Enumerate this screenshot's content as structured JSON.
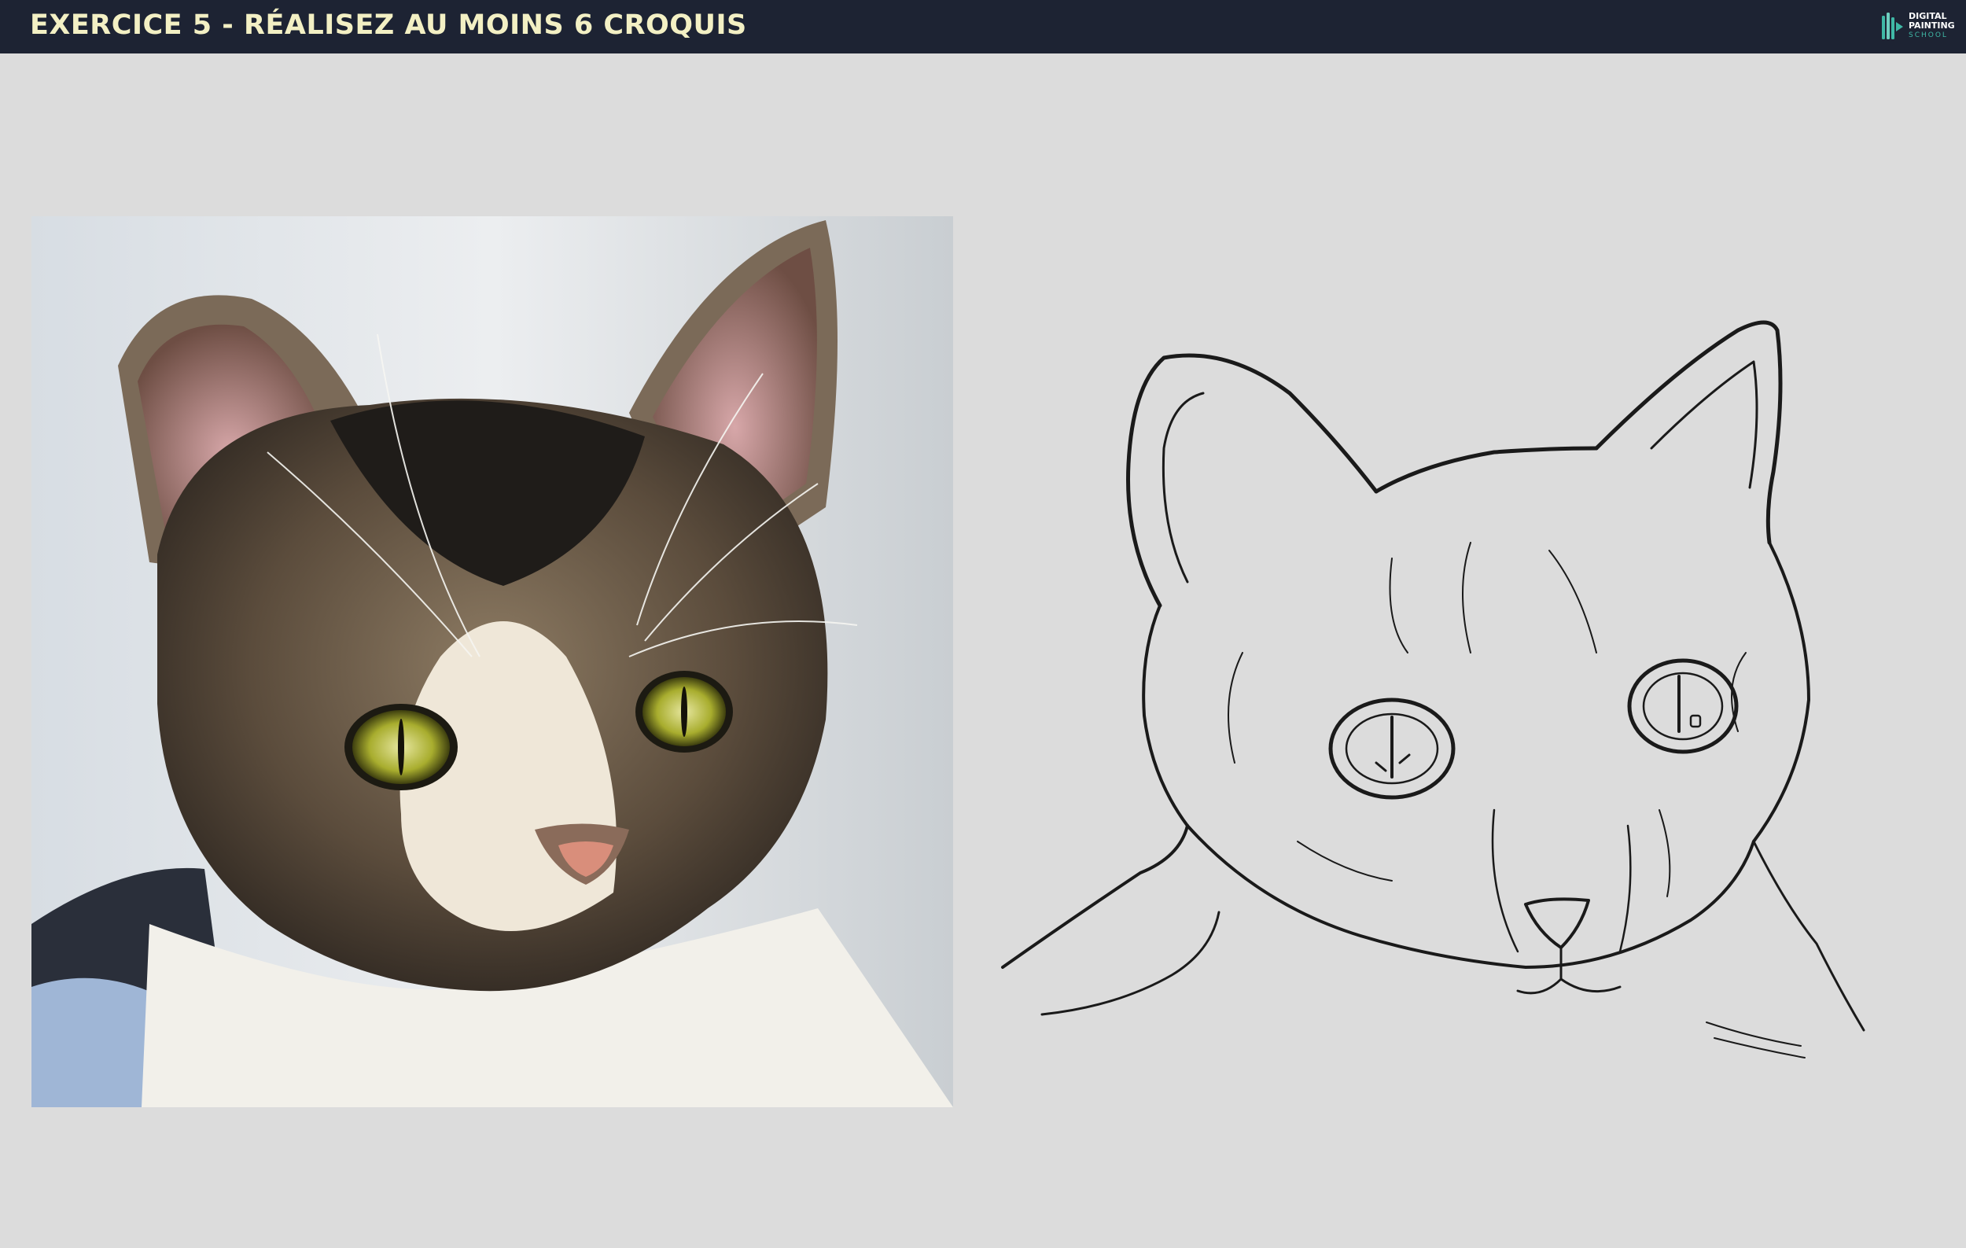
{
  "header": {
    "title": "EXERCICE 5 - RÉALISEZ AU MOINS 6 CROQUIS",
    "background_color": "#1d2333",
    "title_color": "#f3f0c4"
  },
  "logo": {
    "line1": "DIGITAL",
    "line2": "PAINTING",
    "line3": "SCHOOL",
    "accent_color": "#3fb8a6"
  },
  "canvas": {
    "background_color": "#dcdcdc"
  }
}
